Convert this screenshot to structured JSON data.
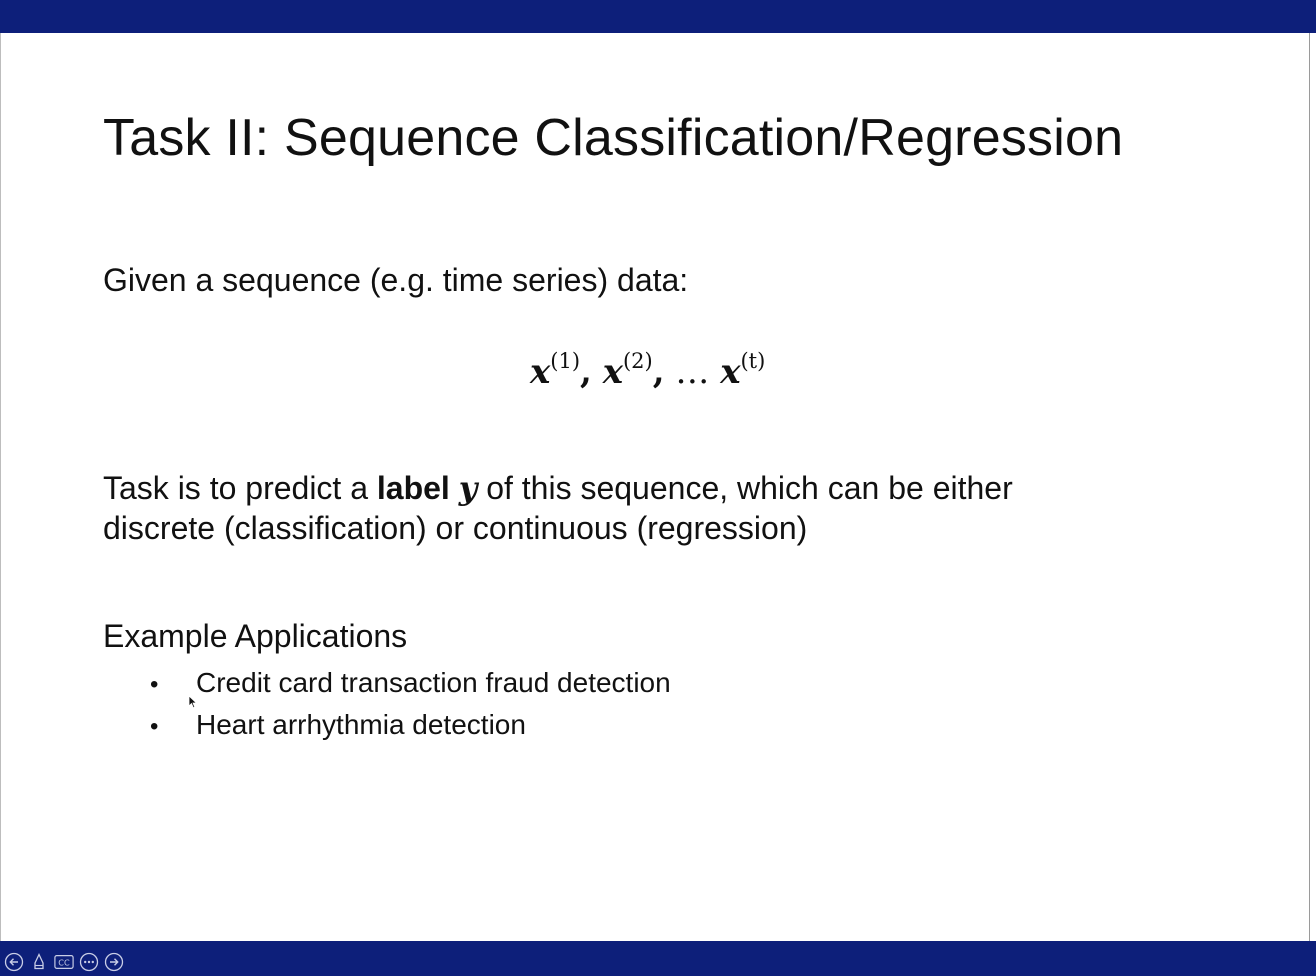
{
  "slide": {
    "title": "Task II: Sequence Classification/Regression",
    "intro": "Given a sequence (e.g. time series) data:",
    "formula": {
      "var": "x",
      "sup1": "(1)",
      "sup2": "(2)",
      "sup3": "(t)",
      "sep": ",",
      "ellipsis": "…"
    },
    "task": {
      "part1": "Task is to predict a ",
      "bold": "label",
      "math": "y",
      "part2": " of this sequence, which can be either",
      "line2": "discrete (classification) or continuous (regression)"
    },
    "examples": {
      "heading": "Example Applications",
      "items": [
        "Credit card transaction fraud detection",
        "Heart arrhythmia detection"
      ],
      "bullet": "•"
    }
  },
  "colors": {
    "bar": "#0d1f7a",
    "text": "#111111",
    "background": "#ffffff"
  },
  "controls": [
    {
      "icon": "arrow-left-icon"
    },
    {
      "icon": "pen-icon"
    },
    {
      "icon": "captions-icon",
      "label": "CC"
    },
    {
      "icon": "more-icon"
    },
    {
      "icon": "arrow-right-icon"
    }
  ]
}
